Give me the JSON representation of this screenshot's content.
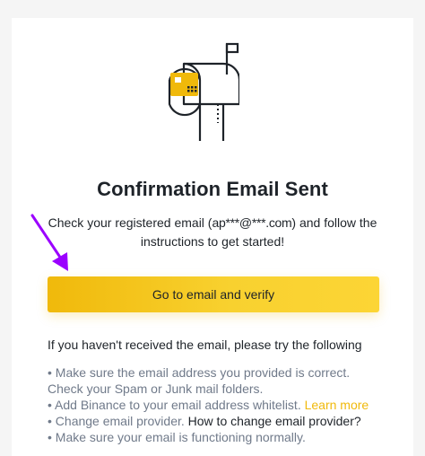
{
  "page": {
    "title": "Confirmation Email Sent",
    "description_prefix": "Check your registered email (",
    "masked_email": "ap***@***.com",
    "description_suffix": ") and follow the instructions to get started!",
    "verify_button_label": "Go to email and verify"
  },
  "help": {
    "heading": "If you haven't received the email, please try the following",
    "tip_1": "• Make sure the email address you provided is correct. Check your Spam or Junk mail folders.",
    "tip_2_prefix": "• Add Binance to your email address whitelist.",
    "learn_more_label": "Learn more",
    "tip_3_prefix": "• Change email provider.",
    "change_provider_link": "How to change email provider?",
    "tip_4": "• Make sure your email is functioning normally."
  },
  "colors": {
    "brand_yellow": "#f0b90b",
    "text_primary": "#1e2329",
    "text_secondary": "#707a8a",
    "annotation_purple": "#9b00ff"
  },
  "icons": {
    "illustration": "mailbox-icon",
    "annotation": "arrow-icon"
  }
}
